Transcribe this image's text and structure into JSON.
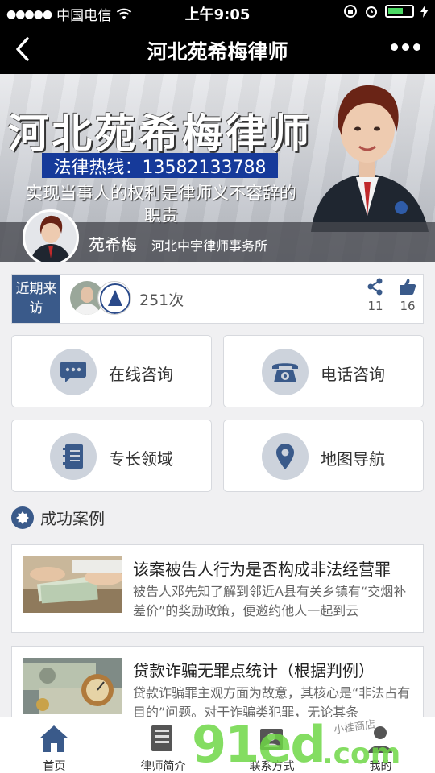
{
  "status_bar": {
    "signal_dots": "●●●●●",
    "carrier": "中国电信",
    "time": "上午9:05"
  },
  "nav": {
    "title": "河北苑希梅律师"
  },
  "banner": {
    "headline": "河北苑希梅律师",
    "hotline": "法律热线：13582133788",
    "slogan": "实现当事人的权利是律师义不容辞的职责",
    "name": "苑希梅",
    "firm": "河北中宇律师事务所"
  },
  "visits": {
    "tag": "近期来访",
    "count": "251次",
    "shares": "11",
    "likes": "16"
  },
  "features": [
    {
      "label": "在线咨询",
      "icon": "chat-icon"
    },
    {
      "label": "电话咨询",
      "icon": "phone-icon"
    },
    {
      "label": "专长领域",
      "icon": "notebook-icon"
    },
    {
      "label": "地图导航",
      "icon": "map-pin-icon"
    }
  ],
  "section": {
    "title": "成功案例"
  },
  "cases": [
    {
      "title": "该案被告人行为是否构成非法经营罪",
      "desc": "被告人邓先知了解到邻近A县有关乡镇有“交烟补差价”的奖励政策，便邀约他人一起到云"
    },
    {
      "title": "贷款诈骗无罪点统计（根据判例）",
      "desc": "贷款诈骗罪主观方面为故意，其核心是“非法占有目的”问题。对于诈骗类犯罪，无论其条"
    }
  ],
  "tabs": [
    {
      "label": "首页",
      "icon": "home-icon"
    },
    {
      "label": "律师简介",
      "icon": "profile-icon"
    },
    {
      "label": "联系方式",
      "icon": "contact-icon"
    },
    {
      "label": "我的",
      "icon": "user-icon"
    }
  ],
  "watermark": {
    "logo": "91ed",
    "suffix": ".com",
    "note": "小桂商店"
  },
  "colors": {
    "accent": "#3a5a8a",
    "hotline_bg": "#163a9a",
    "icon_circle": "#cdd3dc",
    "watermark": "#6ed746"
  }
}
